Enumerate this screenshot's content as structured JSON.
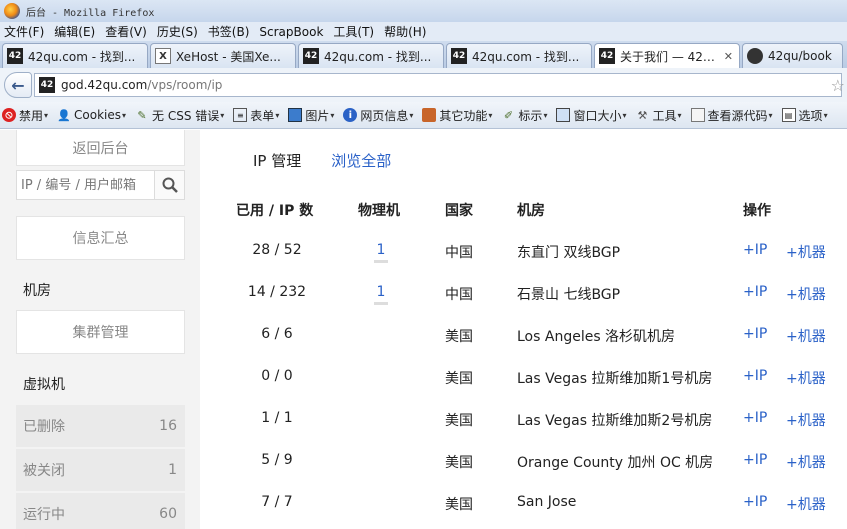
{
  "window": {
    "title": "后台 - Mozilla Firefox"
  },
  "menu": [
    "文件(F)",
    "编辑(E)",
    "查看(V)",
    "历史(S)",
    "书签(B)",
    "ScrapBook",
    "工具(T)",
    "帮助(H)"
  ],
  "tabs": [
    {
      "favicon": "42",
      "label": "42qu.com - 找到..."
    },
    {
      "favicon": "X",
      "label": "XeHost - 美国Xe..."
    },
    {
      "favicon": "42",
      "label": "42qu.com - 找到..."
    },
    {
      "favicon": "42",
      "label": "42qu.com - 找到..."
    },
    {
      "favicon": "42",
      "label": "关于我们 — 42区..."
    },
    {
      "favicon": "gh",
      "label": "42qu/book"
    }
  ],
  "url": {
    "favicon": "42",
    "host": "god.42qu.com",
    "path": "/vps/room/ip"
  },
  "devbar": {
    "disable": "禁用",
    "cookies": "Cookies",
    "css": "无 CSS 错误",
    "forms": "表单",
    "images": "图片",
    "info": "网页信息",
    "misc": "其它功能",
    "outline": "标示",
    "resize": "窗口大小",
    "tools": "工具",
    "source": "查看源代码",
    "options": "选项"
  },
  "sidebar": {
    "back": "返回后台",
    "search_placeholder": "IP / 编号 / 用户邮箱",
    "summary": "信息汇总",
    "rooms_heading": "机房",
    "cluster": "集群管理",
    "vm_heading": "虚拟机",
    "vm_items": [
      {
        "label": "已删除",
        "count": "16"
      },
      {
        "label": "被关闭",
        "count": "1"
      },
      {
        "label": "运行中",
        "count": "60"
      }
    ]
  },
  "main": {
    "tabs": {
      "ip_manage": "IP 管理",
      "browse_all": "浏览全部"
    },
    "headers": {
      "used": "已用 / IP 数",
      "physical": "物理机",
      "country": "国家",
      "room": "机房",
      "ops": "操作"
    },
    "ops": {
      "add_ip": "+IP",
      "add_machine": "+机器"
    },
    "rows": [
      {
        "used": "28 / 52",
        "physical": "1",
        "country": "中国",
        "room": "东直门 双线BGP"
      },
      {
        "used": "14 / 232",
        "physical": "1",
        "country": "中国",
        "room": "石景山 七线BGP"
      },
      {
        "used": "6 / 6",
        "physical": "",
        "country": "美国",
        "room": "Los Angeles 洛杉矶机房"
      },
      {
        "used": "0 / 0",
        "physical": "",
        "country": "美国",
        "room": "Las Vegas 拉斯维加斯1号机房"
      },
      {
        "used": "1 / 1",
        "physical": "",
        "country": "美国",
        "room": "Las Vegas 拉斯维加斯2号机房"
      },
      {
        "used": "5 / 9",
        "physical": "",
        "country": "美国",
        "room": "Orange County 加州 OC 机房"
      },
      {
        "used": "7 / 7",
        "physical": "",
        "country": "美国",
        "room": "San Jose"
      }
    ]
  }
}
